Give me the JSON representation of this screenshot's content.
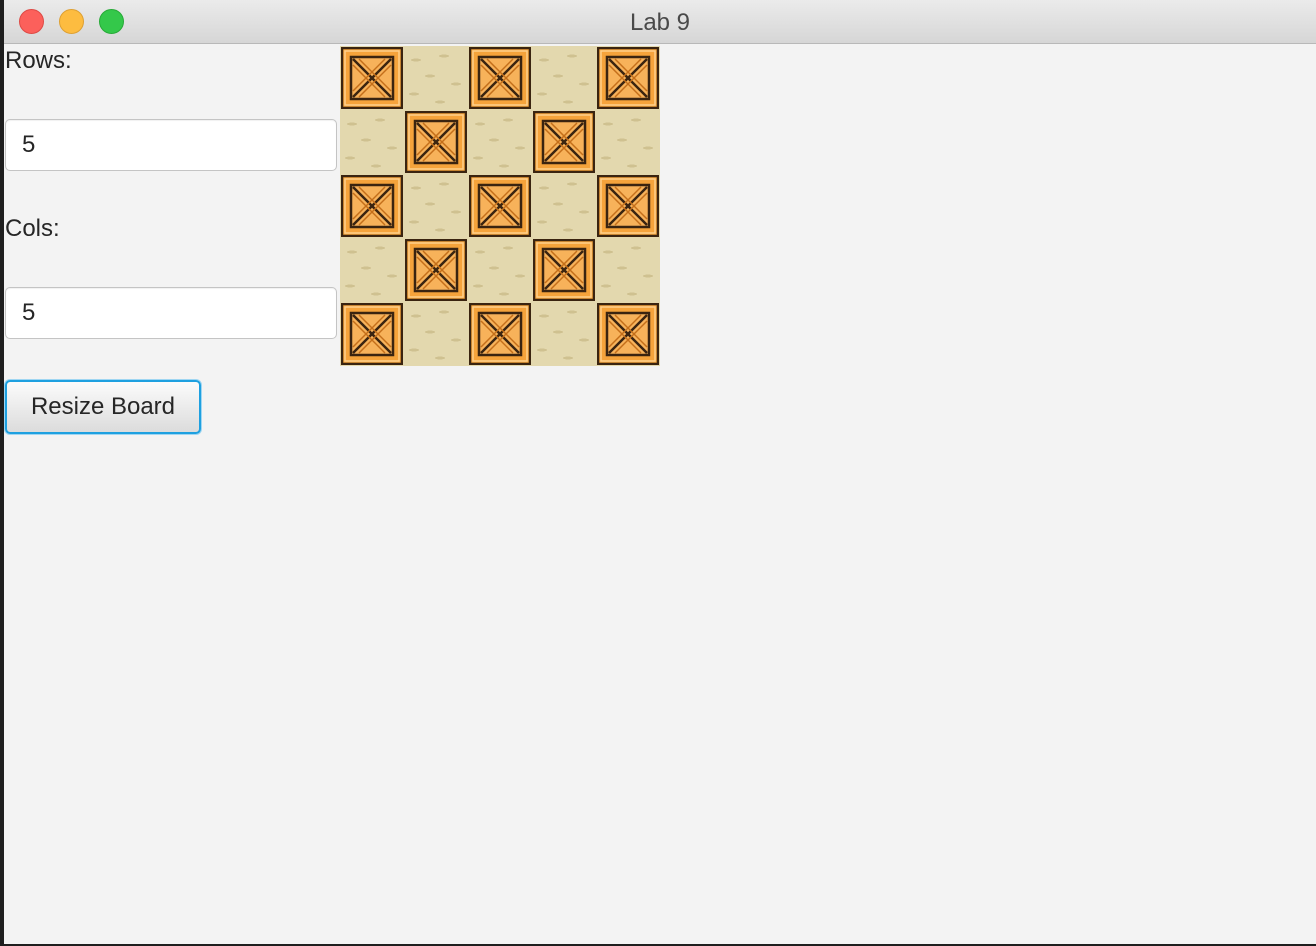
{
  "window": {
    "title": "Lab 9"
  },
  "form": {
    "rows_label": "Rows:",
    "rows_value": "5",
    "cols_label": "Cols:",
    "cols_value": "5",
    "resize_button_label": "Resize Board"
  },
  "board": {
    "rows": 5,
    "cols": 5,
    "cell_pattern": [
      [
        "crate",
        "sand",
        "crate",
        "sand",
        "crate"
      ],
      [
        "sand",
        "crate",
        "sand",
        "crate",
        "sand"
      ],
      [
        "crate",
        "sand",
        "crate",
        "sand",
        "crate"
      ],
      [
        "sand",
        "crate",
        "sand",
        "crate",
        "sand"
      ],
      [
        "crate",
        "sand",
        "crate",
        "sand",
        "crate"
      ]
    ],
    "colors": {
      "sand": "#e3d8ae",
      "crate_fill": "#f5a33b",
      "crate_border": "#3a2410"
    }
  },
  "icons": {
    "crate": "crate-icon",
    "close": "close-dot",
    "minimize": "minimize-dot",
    "maximize": "maximize-dot"
  }
}
